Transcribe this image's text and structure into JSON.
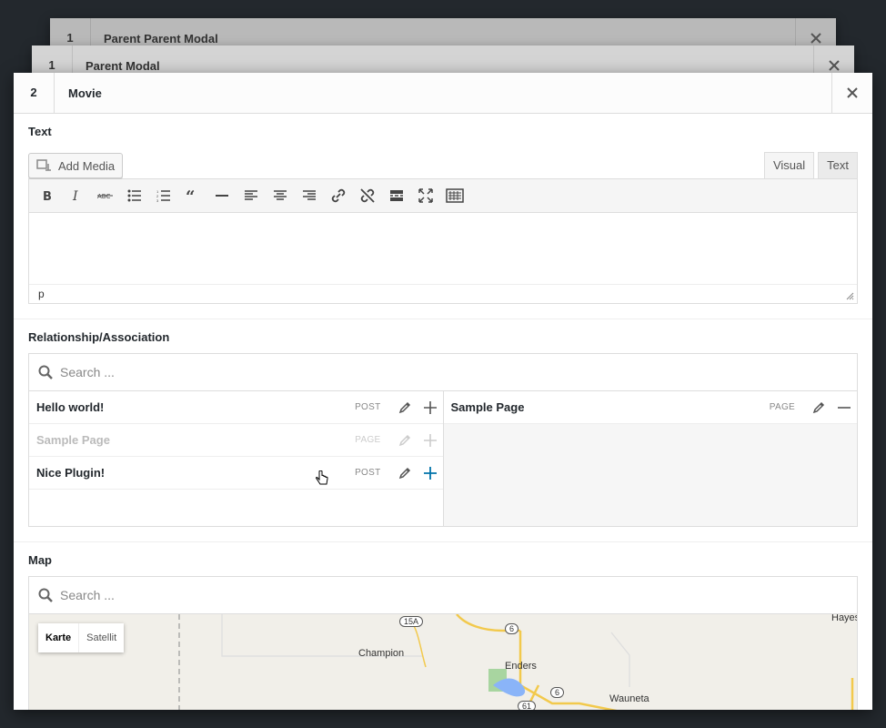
{
  "stack": [
    {
      "num": "1",
      "title": "Parent Parent Modal"
    },
    {
      "num": "1",
      "title": "Parent Modal"
    }
  ],
  "modal": {
    "num": "2",
    "title": "Movie"
  },
  "text_field": {
    "label": "Text",
    "add_media": "Add Media",
    "tabs": [
      "Visual",
      "Text"
    ],
    "status_path": "p"
  },
  "rel_field": {
    "label": "Relationship/Association",
    "search_placeholder": "Search ...",
    "available": [
      {
        "name": "Hello world!",
        "type": "POST",
        "disabled": false
      },
      {
        "name": "Sample Page",
        "type": "PAGE",
        "disabled": true
      },
      {
        "name": "Nice Plugin!",
        "type": "POST",
        "disabled": false
      }
    ],
    "selected": [
      {
        "name": "Sample Page",
        "type": "PAGE"
      }
    ]
  },
  "map_field": {
    "label": "Map",
    "search_placeholder": "Search ...",
    "map_types": [
      "Karte",
      "Satellit"
    ],
    "places": [
      "Champion",
      "Enders",
      "Wauneta",
      "Hayes"
    ],
    "routes": [
      "15A",
      "6",
      "6",
      "61"
    ]
  },
  "colors": {
    "accent": "#0073aa",
    "backdrop": "#23282d"
  }
}
